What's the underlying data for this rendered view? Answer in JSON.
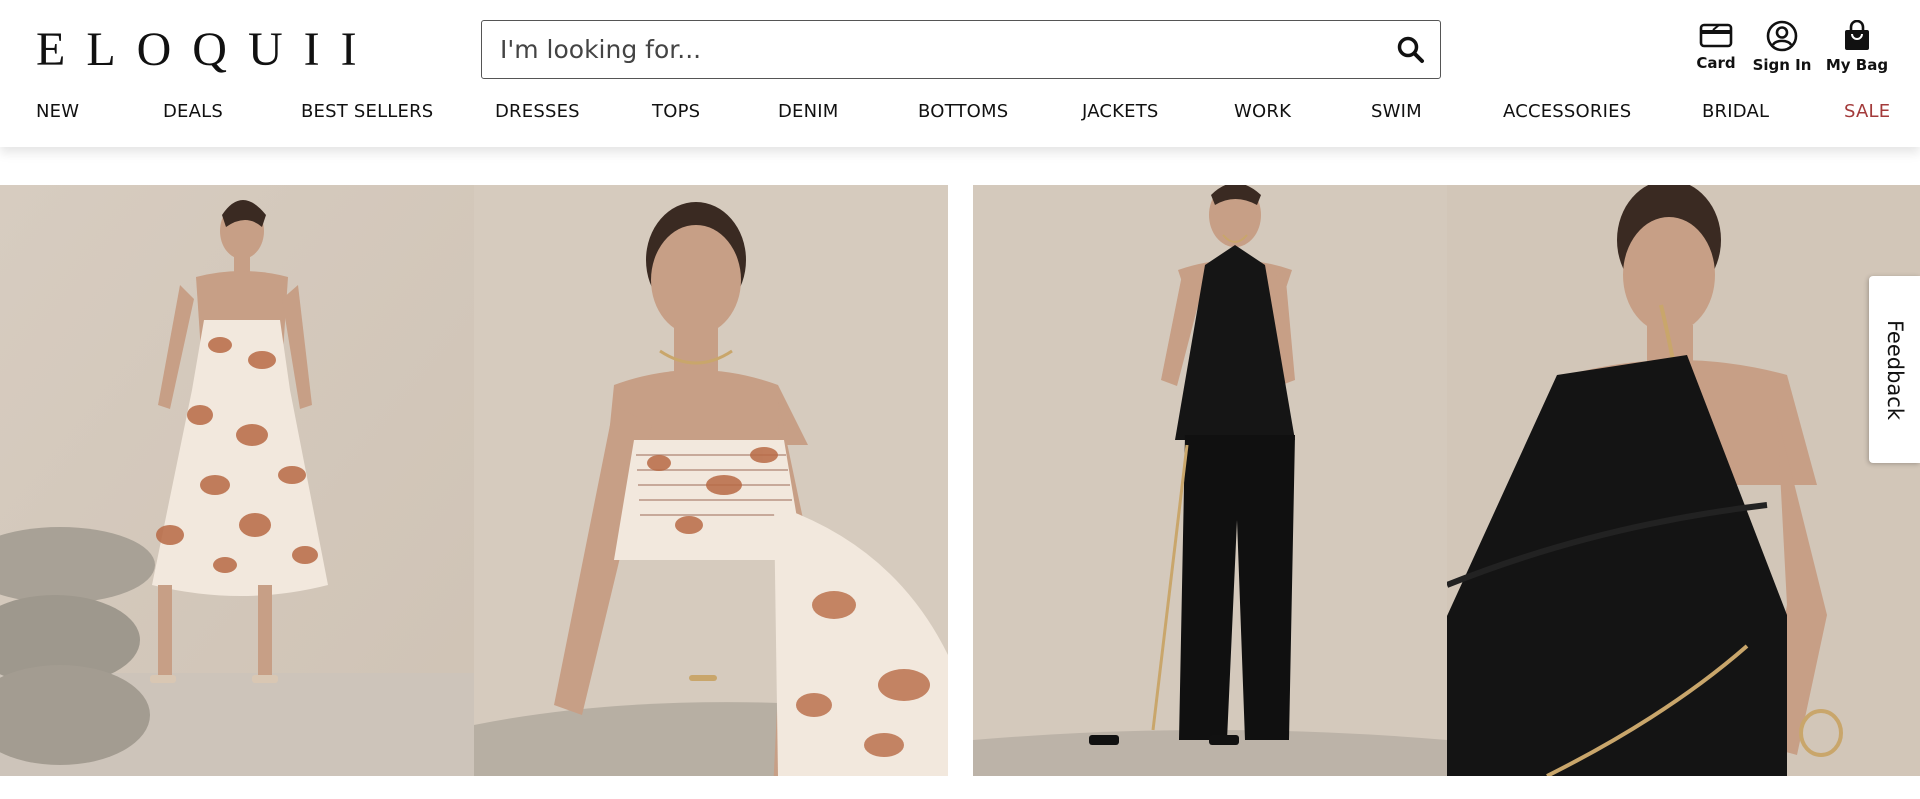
{
  "brand": {
    "logo_text": "ELOQUII"
  },
  "search": {
    "placeholder": "I'm looking for...",
    "icon": "search-icon"
  },
  "utility": {
    "card": {
      "label": "Card",
      "icon": "credit-card-icon"
    },
    "sign_in": {
      "label": "Sign In",
      "icon": "user-circle-icon"
    },
    "bag": {
      "label": "My Bag",
      "icon": "shopping-bag-icon"
    }
  },
  "nav": {
    "items": [
      {
        "label": "NEW"
      },
      {
        "label": "DEALS"
      },
      {
        "label": "BEST SELLERS"
      },
      {
        "label": "DRESSES"
      },
      {
        "label": "TOPS"
      },
      {
        "label": "DENIM"
      },
      {
        "label": "BOTTOMS"
      },
      {
        "label": "JACKETS"
      },
      {
        "label": "WORK"
      },
      {
        "label": "SWIM"
      },
      {
        "label": "ACCESSORIES"
      },
      {
        "label": "BRIDAL"
      },
      {
        "label": "SALE",
        "color": "#a33a3a"
      }
    ]
  },
  "feedback": {
    "label": "Feedback"
  },
  "colors": {
    "nav_sale": "#a33a3a",
    "backdrop": "#d8cdc0",
    "text": "#111111"
  }
}
